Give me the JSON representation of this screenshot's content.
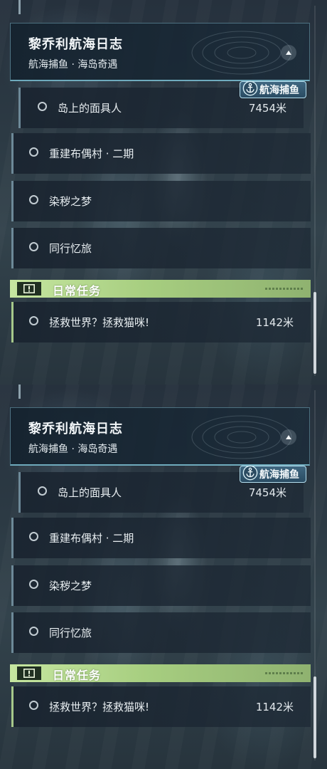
{
  "journal": {
    "title": "黎乔利航海日志",
    "subtitle": "航海捕鱼 · 海岛奇遇"
  },
  "badge": {
    "label": "航海捕鱼",
    "icon": "anchor-icon"
  },
  "quests": [
    {
      "label": "岛上的面具人",
      "distance": "7454米",
      "tracked": true
    },
    {
      "label": "重建布偶村 · 二期",
      "distance": ""
    },
    {
      "label": "染秽之梦",
      "distance": ""
    },
    {
      "label": "同行忆旅",
      "distance": ""
    }
  ],
  "daily": {
    "title": "日常任务",
    "icon": "alert-icon",
    "quests": [
      {
        "label": "拯救世界？拯救猫咪!",
        "distance": "1142米"
      }
    ]
  },
  "colors": {
    "accent_cyan": "#8cd7eb",
    "daily_green": "#a7ce80",
    "badge_blue": "#3f6781"
  }
}
